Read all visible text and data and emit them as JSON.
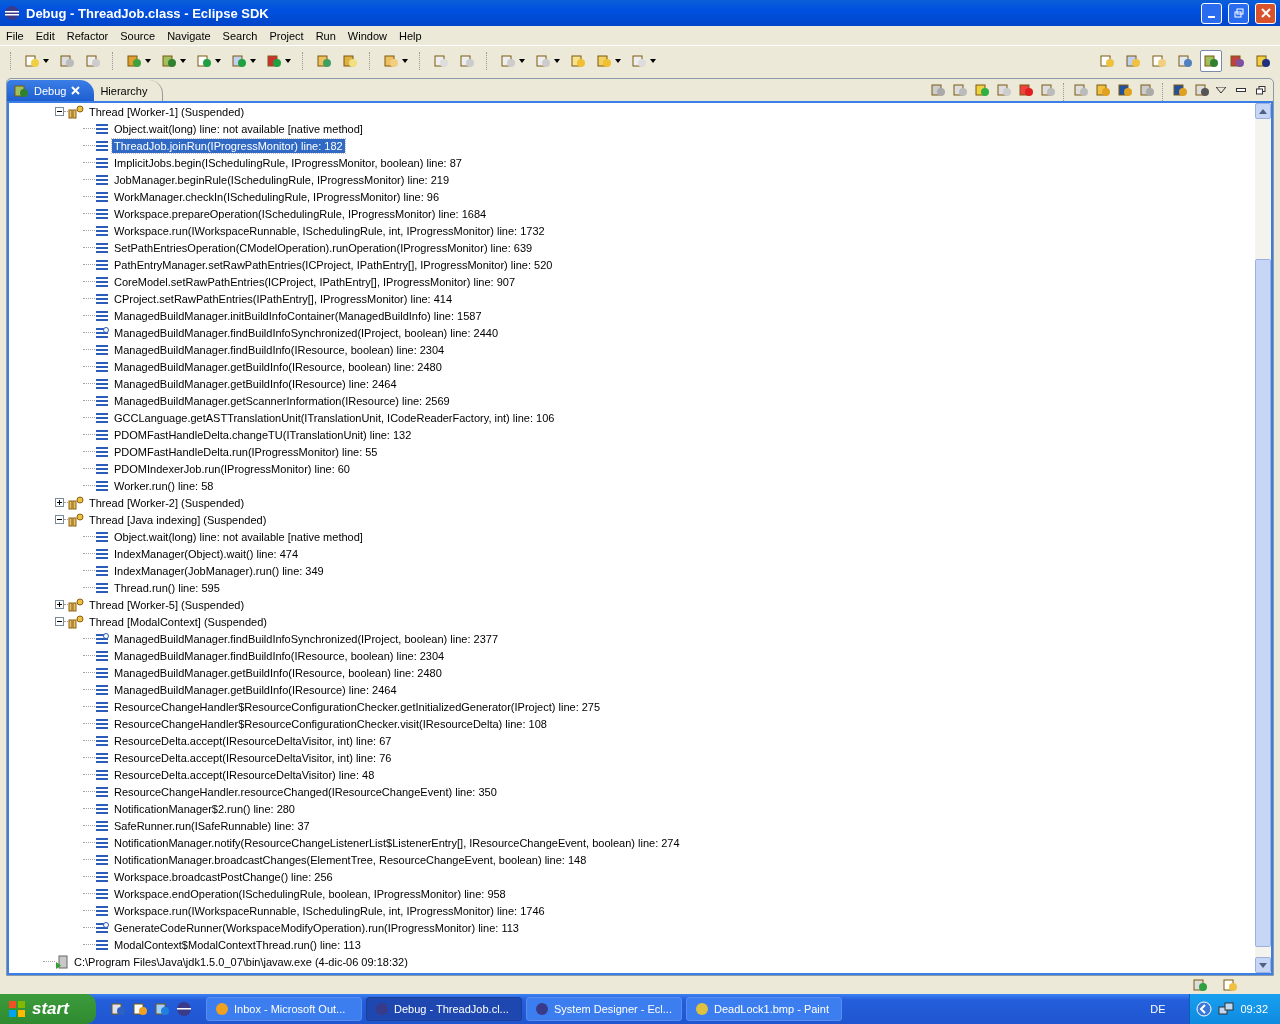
{
  "window": {
    "title": "Debug - ThreadJob.class - Eclipse SDK"
  },
  "menu": [
    "File",
    "Edit",
    "Refactor",
    "Source",
    "Navigate",
    "Search",
    "Project",
    "Run",
    "Window",
    "Help"
  ],
  "view_tabs": [
    {
      "label": "Debug",
      "selected": true
    },
    {
      "label": "Hierarchy",
      "selected": false
    }
  ],
  "debug_tree": {
    "threads": [
      {
        "label": "Thread [Worker-1] (Suspended)",
        "expanded": true,
        "frames": [
          {
            "kind": "frame",
            "label": "Object.wait(long) line: not available [native method]",
            "selected": false
          },
          {
            "kind": "frame",
            "label": "ThreadJob.joinRun(IProgressMonitor) line: 182",
            "selected": true
          },
          {
            "kind": "frame",
            "label": "ImplicitJobs.begin(ISchedulingRule, IProgressMonitor, boolean) line: 87",
            "selected": false
          },
          {
            "kind": "frame",
            "label": "JobManager.beginRule(ISchedulingRule, IProgressMonitor) line: 219",
            "selected": false
          },
          {
            "kind": "frame",
            "label": "WorkManager.checkIn(ISchedulingRule, IProgressMonitor) line: 96",
            "selected": false
          },
          {
            "kind": "frame",
            "label": "Workspace.prepareOperation(ISchedulingRule, IProgressMonitor) line: 1684",
            "selected": false
          },
          {
            "kind": "frame",
            "label": "Workspace.run(IWorkspaceRunnable, ISchedulingRule, int, IProgressMonitor) line: 1732",
            "selected": false
          },
          {
            "kind": "frame",
            "label": "SetPathEntriesOperation(CModelOperation).runOperation(IProgressMonitor) line: 639",
            "selected": false
          },
          {
            "kind": "frame",
            "label": "PathEntryManager.setRawPathEntries(ICProject, IPathEntry[], IProgressMonitor) line: 520",
            "selected": false
          },
          {
            "kind": "frame",
            "label": "CoreModel.setRawPathEntries(ICProject, IPathEntry[], IProgressMonitor) line: 907",
            "selected": false
          },
          {
            "kind": "frame",
            "label": "CProject.setRawPathEntries(IPathEntry[], IProgressMonitor) line: 414",
            "selected": false
          },
          {
            "kind": "frame",
            "label": "ManagedBuildManager.initBuildInfoContainer(ManagedBuildInfo) line: 1587",
            "selected": false
          },
          {
            "kind": "synchronized",
            "label": "ManagedBuildManager.findBuildInfoSynchronized(IProject, boolean) line: 2440",
            "selected": false
          },
          {
            "kind": "frame",
            "label": "ManagedBuildManager.findBuildInfo(IResource, boolean) line: 2304",
            "selected": false
          },
          {
            "kind": "frame",
            "label": "ManagedBuildManager.getBuildInfo(IResource, boolean) line: 2480",
            "selected": false
          },
          {
            "kind": "frame",
            "label": "ManagedBuildManager.getBuildInfo(IResource) line: 2464",
            "selected": false
          },
          {
            "kind": "frame",
            "label": "ManagedBuildManager.getScannerInformation(IResource) line: 2569",
            "selected": false
          },
          {
            "kind": "frame",
            "label": "GCCLanguage.getASTTranslationUnit(ITranslationUnit, ICodeReaderFactory, int) line: 106",
            "selected": false
          },
          {
            "kind": "frame",
            "label": "PDOMFastHandleDelta.changeTU(ITranslationUnit) line: 132",
            "selected": false
          },
          {
            "kind": "frame",
            "label": "PDOMFastHandleDelta.run(IProgressMonitor) line: 55",
            "selected": false
          },
          {
            "kind": "frame",
            "label": "PDOMIndexerJob.run(IProgressMonitor) line: 60",
            "selected": false
          },
          {
            "kind": "frame",
            "label": "Worker.run() line: 58",
            "selected": false
          }
        ]
      },
      {
        "label": "Thread [Worker-2] (Suspended)",
        "expanded": false
      },
      {
        "label": "Thread [Java indexing] (Suspended)",
        "expanded": true,
        "frames": [
          {
            "kind": "frame",
            "label": "Object.wait(long) line: not available [native method]",
            "selected": false
          },
          {
            "kind": "frame",
            "label": "IndexManager(Object).wait() line: 474",
            "selected": false
          },
          {
            "kind": "frame",
            "label": "IndexManager(JobManager).run() line: 349",
            "selected": false
          },
          {
            "kind": "frame",
            "label": "Thread.run() line: 595",
            "selected": false
          }
        ]
      },
      {
        "label": "Thread [Worker-5] (Suspended)",
        "expanded": false
      },
      {
        "label": "Thread [ModalContext] (Suspended)",
        "expanded": true,
        "frames": [
          {
            "kind": "synchronized",
            "label": "ManagedBuildManager.findBuildInfoSynchronized(IProject, boolean) line: 2377",
            "selected": false
          },
          {
            "kind": "frame",
            "label": "ManagedBuildManager.findBuildInfo(IResource, boolean) line: 2304",
            "selected": false
          },
          {
            "kind": "frame",
            "label": "ManagedBuildManager.getBuildInfo(IResource, boolean) line: 2480",
            "selected": false
          },
          {
            "kind": "frame",
            "label": "ManagedBuildManager.getBuildInfo(IResource) line: 2464",
            "selected": false
          },
          {
            "kind": "frame",
            "label": "ResourceChangeHandler$ResourceConfigurationChecker.getInitializedGenerator(IProject) line: 275",
            "selected": false
          },
          {
            "kind": "frame",
            "label": "ResourceChangeHandler$ResourceConfigurationChecker.visit(IResourceDelta) line: 108",
            "selected": false
          },
          {
            "kind": "frame",
            "label": "ResourceDelta.accept(IResourceDeltaVisitor, int) line: 67",
            "selected": false
          },
          {
            "kind": "frame",
            "label": "ResourceDelta.accept(IResourceDeltaVisitor, int) line: 76",
            "selected": false
          },
          {
            "kind": "frame",
            "label": "ResourceDelta.accept(IResourceDeltaVisitor) line: 48",
            "selected": false
          },
          {
            "kind": "frame",
            "label": "ResourceChangeHandler.resourceChanged(IResourceChangeEvent) line: 350",
            "selected": false
          },
          {
            "kind": "frame",
            "label": "NotificationManager$2.run() line: 280",
            "selected": false
          },
          {
            "kind": "frame",
            "label": "SafeRunner.run(ISafeRunnable) line: 37",
            "selected": false
          },
          {
            "kind": "frame",
            "label": "NotificationManager.notify(ResourceChangeListenerList$ListenerEntry[], IResourceChangeEvent, boolean) line: 274",
            "selected": false
          },
          {
            "kind": "frame",
            "label": "NotificationManager.broadcastChanges(ElementTree, ResourceChangeEvent, boolean) line: 148",
            "selected": false
          },
          {
            "kind": "frame",
            "label": "Workspace.broadcastPostChange() line: 256",
            "selected": false
          },
          {
            "kind": "frame",
            "label": "Workspace.endOperation(ISchedulingRule, boolean, IProgressMonitor) line: 958",
            "selected": false
          },
          {
            "kind": "frame",
            "label": "Workspace.run(IWorkspaceRunnable, ISchedulingRule, int, IProgressMonitor) line: 1746",
            "selected": false
          },
          {
            "kind": "synchronized",
            "label": "GenerateCodeRunner(WorkspaceModifyOperation).run(IProgressMonitor) line: 113",
            "selected": false
          },
          {
            "kind": "frame",
            "label": "ModalContext$ModalContextThread.run() line: 113",
            "selected": false
          }
        ]
      }
    ],
    "process": {
      "label": "C:\\Program Files\\Java\\jdk1.5.0_07\\bin\\javaw.exe (4-dic-06 09:18:32)"
    }
  },
  "taskbar": {
    "start": "start",
    "tasks": [
      {
        "label": "Inbox - Microsoft Out...",
        "selected": false
      },
      {
        "label": "Debug - ThreadJob.cl...",
        "selected": true
      },
      {
        "label": "System Designer - Ecl...",
        "selected": false
      },
      {
        "label": "DeadLock1.bmp - Paint",
        "selected": false
      }
    ],
    "language": "DE",
    "clock": "09:32"
  }
}
